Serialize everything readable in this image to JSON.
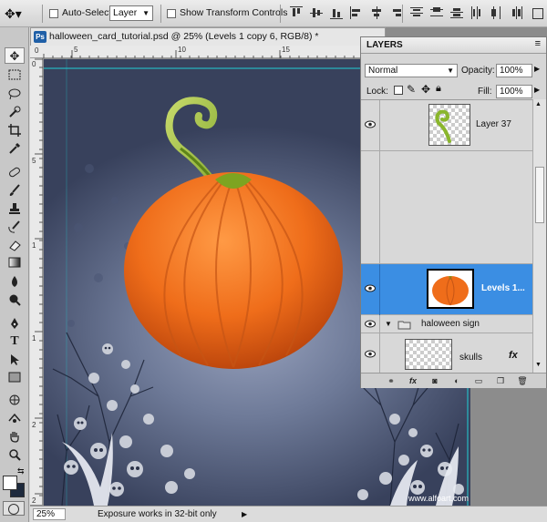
{
  "options_bar": {
    "auto_select_label": "Auto-Select:",
    "auto_select_value": "Layer",
    "show_transform_label": "Show Transform Controls"
  },
  "document": {
    "ps_badge": "Ps",
    "tab_title": "halloween_card_tutorial.psd @ 25% (Levels 1 copy 6, RGB/8) *",
    "ruler_top": [
      "0",
      "5",
      "10",
      "15"
    ],
    "ruler_left": [
      "0",
      "5",
      "1",
      "1",
      "2",
      "2"
    ],
    "zoom": "25%",
    "status_message": "Exposure works in 32-bit only",
    "watermark": "www.alfoart.com"
  },
  "layers_panel": {
    "title": "LAYERS",
    "blend_mode": "Normal",
    "opacity_label": "Opacity:",
    "opacity_value": "100%",
    "lock_label": "Lock:",
    "fill_label": "Fill:",
    "fill_value": "100%",
    "layers": [
      {
        "name": "Layer 37",
        "visible": true,
        "selected": false
      },
      {
        "name": "Levels 1...",
        "visible": true,
        "selected": true
      },
      {
        "name": "haloween sign",
        "visible": true,
        "selected": false,
        "group": true
      },
      {
        "name": "skulls",
        "visible": true,
        "selected": false,
        "fx": "fx"
      }
    ],
    "footer_icons": [
      "link-icon",
      "fx-icon",
      "mask-icon",
      "adjustment-icon",
      "group-icon",
      "new-layer-icon",
      "trash-icon"
    ],
    "footer_fx": "fx"
  },
  "colors": {
    "canvas_dark": "#38415c",
    "canvas_light": "#9aa4bf",
    "pumpkin": "#ef6d1a",
    "stem": "#8ab62c",
    "selection": "#3b8ee3",
    "guide": "#1fd0d6"
  }
}
